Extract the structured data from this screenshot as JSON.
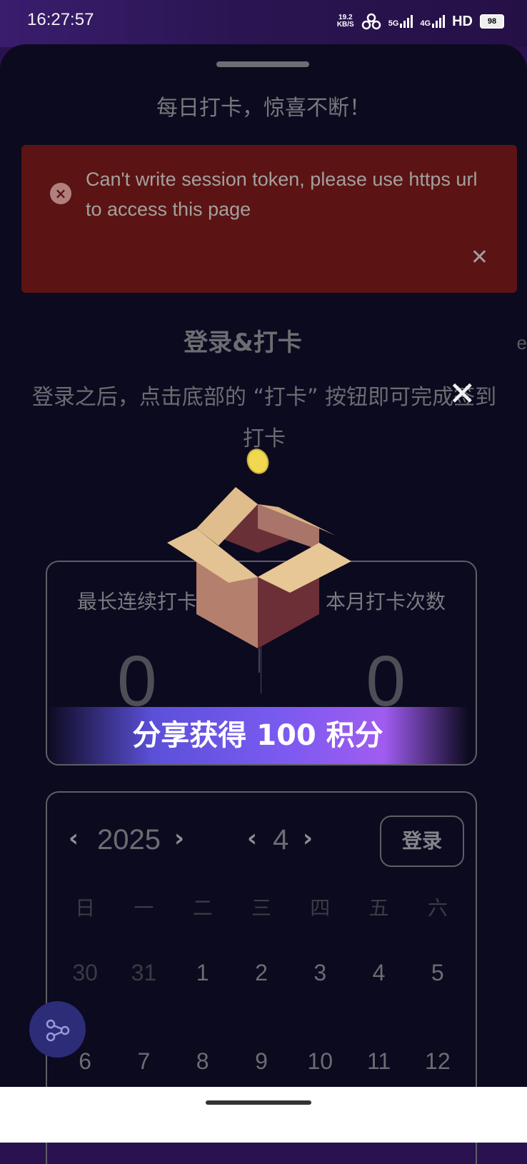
{
  "status_bar": {
    "time": "16:27:57",
    "net_speed_value": "19.2",
    "net_speed_unit": "KB/S",
    "sig1_label": "5G",
    "sig2_label": "4G",
    "hd_label": "HD",
    "battery": "98"
  },
  "headline": "每日打卡，惊喜不断！",
  "alert": {
    "message": "Can't write session token, please use https url to access this page",
    "icon": "close-circle-icon",
    "close_icon": "close-icon",
    "color": "#5b1413"
  },
  "edge_text": "e",
  "login_section": {
    "title": "登录&打卡",
    "description": "登录之后，点击底部的 “打卡” 按钮即可完成签到打卡"
  },
  "stats": {
    "longest_streak_label": "最长连续打卡",
    "longest_streak_value": "0",
    "month_count_label": "本月打卡次数",
    "month_count_value": "0"
  },
  "share_banner": {
    "text": "分享获得 100 积分"
  },
  "calendar": {
    "year": "2025",
    "month": "4",
    "login_button": "登录",
    "weekdays": [
      "日",
      "一",
      "二",
      "三",
      "四",
      "五",
      "六"
    ],
    "weeks": [
      [
        "30",
        "31",
        "1",
        "2",
        "3",
        "4",
        "5"
      ],
      [
        "6",
        "7",
        "8",
        "9",
        "10",
        "11",
        "12"
      ]
    ],
    "prev_icon": "chevron-left-icon",
    "next_icon": "chevron-right-icon"
  },
  "share_fab_icon": "share-icon",
  "overlay_close_icon": "close-icon",
  "accent_colors": {
    "banner_start": "#5b50d8",
    "banner_end": "#a05cf0",
    "box": "#c18d78"
  }
}
